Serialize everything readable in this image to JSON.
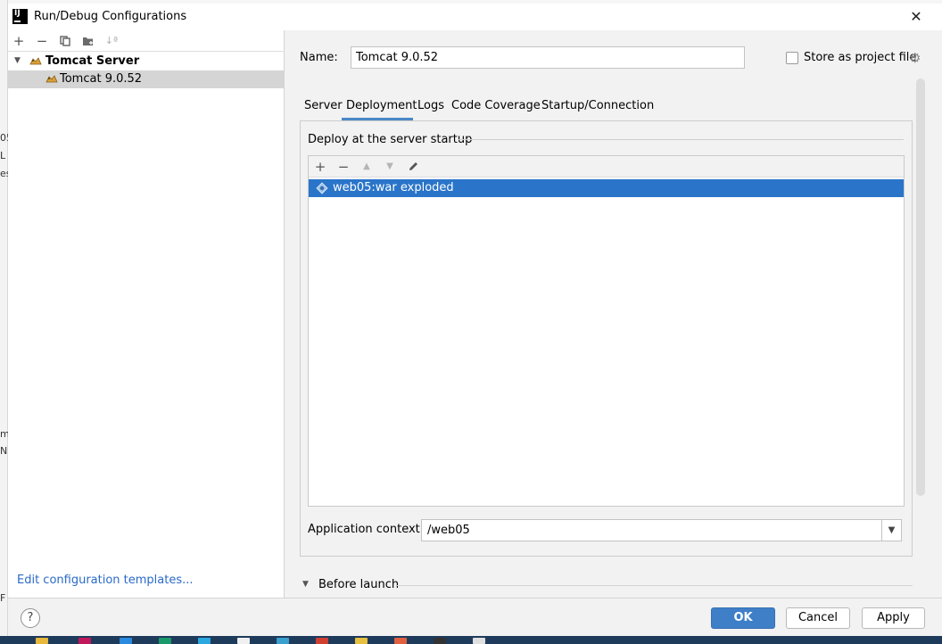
{
  "window": {
    "title": "Run/Debug Configurations",
    "app_icon": "IJ"
  },
  "left_toolbar": {
    "icons": [
      "add-icon",
      "remove-icon",
      "copy-icon",
      "folder-icon",
      "sort-icon"
    ]
  },
  "tree": {
    "root_label": "Tomcat Server",
    "child_label": "Tomcat 9.0.52"
  },
  "edit_templates_link": "Edit configuration templates...",
  "name_field": {
    "label": "Name:",
    "value": "Tomcat 9.0.52"
  },
  "store_project": {
    "label": "Store as project file",
    "checked": false
  },
  "tabs": [
    {
      "label": "Server"
    },
    {
      "label": "Deployment"
    },
    {
      "label": "Logs"
    },
    {
      "label": "Code Coverage"
    },
    {
      "label": "Startup/Connection"
    }
  ],
  "active_tab": "Deployment",
  "deployment": {
    "section_label": "Deploy at the server startup",
    "artifacts": [
      {
        "label": "web05:war exploded",
        "selected": true
      }
    ],
    "app_context": {
      "label": "Application context:",
      "value": "/web05"
    }
  },
  "before_launch": {
    "label": "Before launch"
  },
  "buttons": {
    "ok": "OK",
    "cancel": "Cancel",
    "apply": "Apply",
    "help": "?"
  },
  "colors": {
    "accent": "#3f7fc8",
    "selection": "#2a75c9",
    "link": "#2a6ac8"
  },
  "background_fragments": [
    "05",
    "L",
    "es",
    "m",
    "N",
    "F"
  ]
}
